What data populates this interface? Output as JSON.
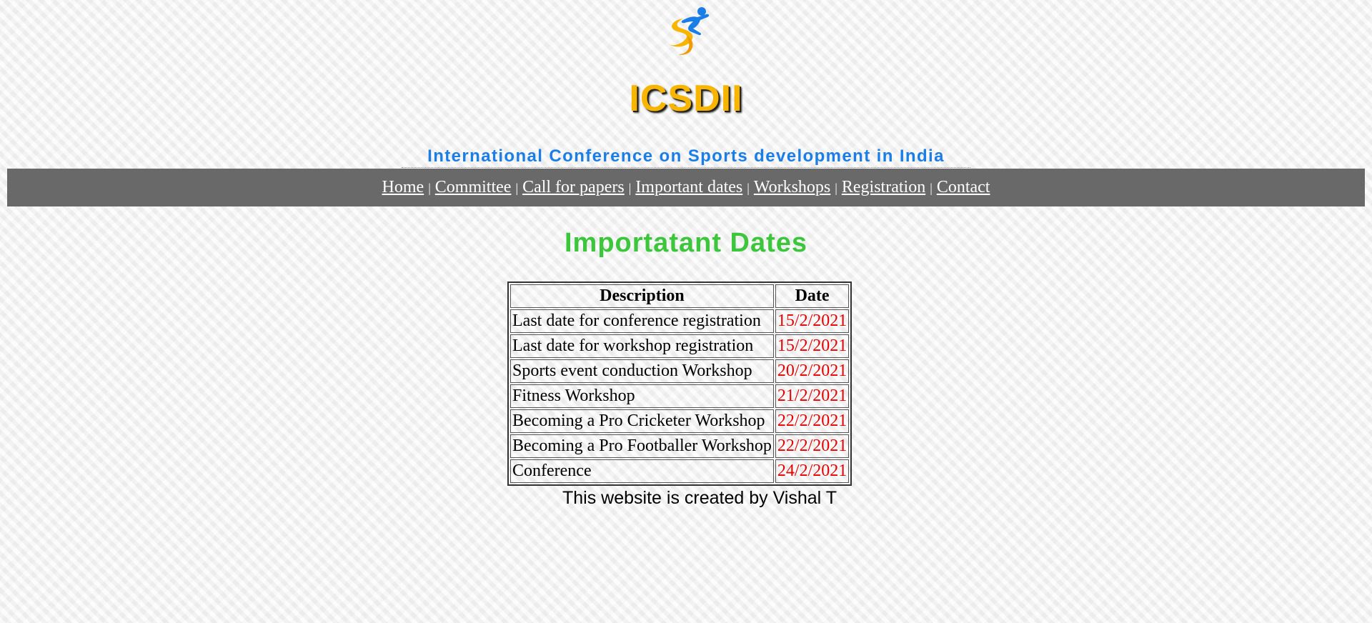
{
  "header": {
    "logo_icon": "sports-figure-logo-icon",
    "title": "ICSDII",
    "subtitle": "International Conference on Sports development in India",
    "colors": {
      "title": "#f7b500",
      "subtitle": "#1a7ee6"
    }
  },
  "nav": {
    "separator": "|",
    "items": [
      {
        "label": "Home"
      },
      {
        "label": "Committee"
      },
      {
        "label": "Call for papers"
      },
      {
        "label": "Important dates"
      },
      {
        "label": "Workshops"
      },
      {
        "label": "Registration"
      },
      {
        "label": "Contact"
      }
    ],
    "background": "#696969"
  },
  "main": {
    "title": "Importatant Dates",
    "title_color": "#3cc63c",
    "table": {
      "headers": [
        "Description",
        "Date"
      ],
      "rows": [
        {
          "description": "Last date for conference registration",
          "date": "15/2/2021"
        },
        {
          "description": "Last date for workshop registration",
          "date": "15/2/2021"
        },
        {
          "description": "Sports event conduction Workshop",
          "date": "20/2/2021"
        },
        {
          "description": "Fitness Workshop",
          "date": "21/2/2021"
        },
        {
          "description": "Becoming a Pro Cricketer Workshop",
          "date": "22/2/2021"
        },
        {
          "description": "Becoming a Pro Footballer Workshop",
          "date": "22/2/2021"
        },
        {
          "description": "Conference",
          "date": "24/2/2021"
        }
      ],
      "date_color": "#e60000"
    }
  },
  "footer": {
    "text": "This website is created by Vishal T"
  }
}
